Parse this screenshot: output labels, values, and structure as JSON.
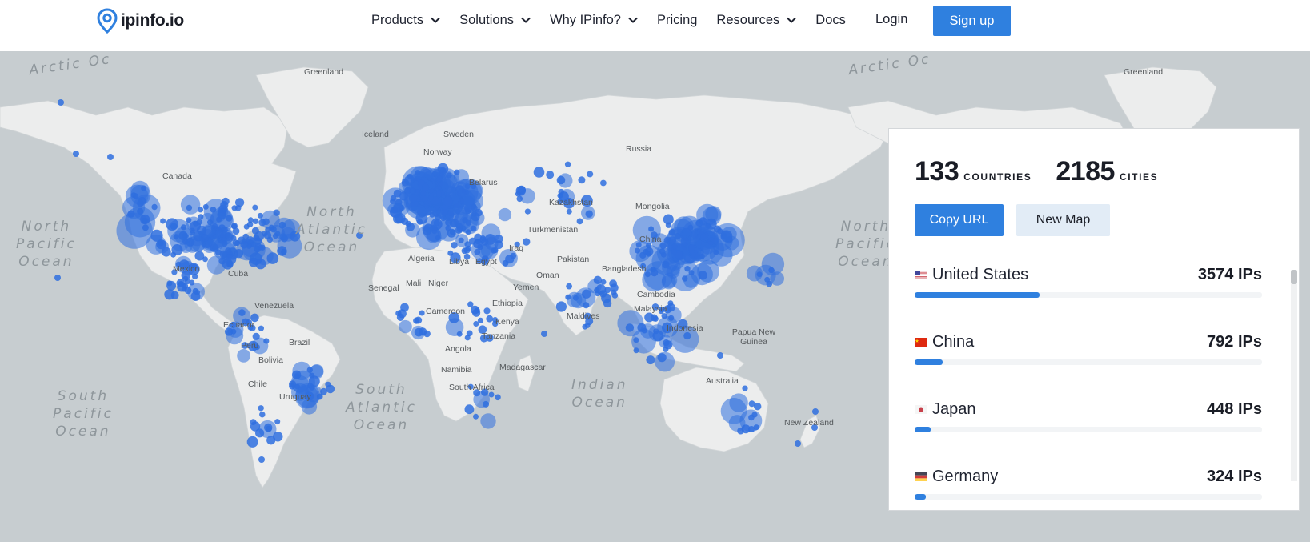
{
  "header": {
    "logo_text": "ipinfo.io",
    "nav": [
      {
        "label": "Products",
        "dropdown": true
      },
      {
        "label": "Solutions",
        "dropdown": true
      },
      {
        "label": "Why IPinfo?",
        "dropdown": true
      },
      {
        "label": "Pricing",
        "dropdown": false
      },
      {
        "label": "Resources",
        "dropdown": true
      },
      {
        "label": "Docs",
        "dropdown": false
      }
    ],
    "login": "Login",
    "signup": "Sign up"
  },
  "map": {
    "ocean_labels": [
      {
        "id": "arctic-ocean-left",
        "text": "Arctic Oc"
      },
      {
        "id": "north-pacific-left",
        "text": "North\nPacific\nOcean"
      },
      {
        "id": "north-atlantic",
        "text": "North\nAtlantic\nOcean"
      },
      {
        "id": "south-atlantic",
        "text": "South\nAtlantic\nOcean"
      },
      {
        "id": "south-pacific",
        "text": "South\nPacific\nOcean"
      },
      {
        "id": "indian-ocean",
        "text": "Indian\nOcean"
      },
      {
        "id": "arctic-ocean-right",
        "text": "Arctic Oc"
      },
      {
        "id": "north-pacific-right",
        "text": "North\nPacific\nOcean"
      }
    ],
    "country_labels": [
      "Greenland",
      "Canada",
      "Iceland",
      "Sweden",
      "Norway",
      "Russia",
      "Belarus",
      "Kazakhstan",
      "Mongolia",
      "Turkmenistan",
      "China",
      "Iraq",
      "Pakistan",
      "Oman",
      "Yemen",
      "Egypt",
      "Libya",
      "Algeria",
      "Mali",
      "Niger",
      "Senegal",
      "Cameroon",
      "Ethiopia",
      "Kenya",
      "Tanzania",
      "Angola",
      "Namibia",
      "Madagascar",
      "South Africa",
      "Cuba",
      "Mexico",
      "Venezuela",
      "Ecuador",
      "Peru",
      "Brazil",
      "Bolivia",
      "Chile",
      "Uruguay",
      "Maldives",
      "Bangladesh",
      "Cambodia",
      "Malaysia",
      "Indonesia",
      "Papua New Guinea",
      "Australia",
      "New Zealand",
      "Greenland"
    ],
    "dot_color": "#2f6fdf"
  },
  "panel": {
    "countries_count": "133",
    "countries_label": "COUNTRIES",
    "cities_count": "2185",
    "cities_label": "CITIES",
    "copy_url": "Copy URL",
    "new_map": "New Map",
    "rows": [
      {
        "country": "United States",
        "count": "3574 IPs",
        "flag": "us-flag",
        "fraction": 0.36
      },
      {
        "country": "China",
        "count": "792 IPs",
        "flag": "cn-flag",
        "fraction": 0.08
      },
      {
        "country": "Japan",
        "count": "448 IPs",
        "flag": "jp-flag",
        "fraction": 0.045
      },
      {
        "country": "Germany",
        "count": "324 IPs",
        "flag": "de-flag",
        "fraction": 0.033
      }
    ]
  },
  "colors": {
    "accent": "#2f80df",
    "map_water": "#c7cdd0",
    "map_land": "#eceded"
  }
}
